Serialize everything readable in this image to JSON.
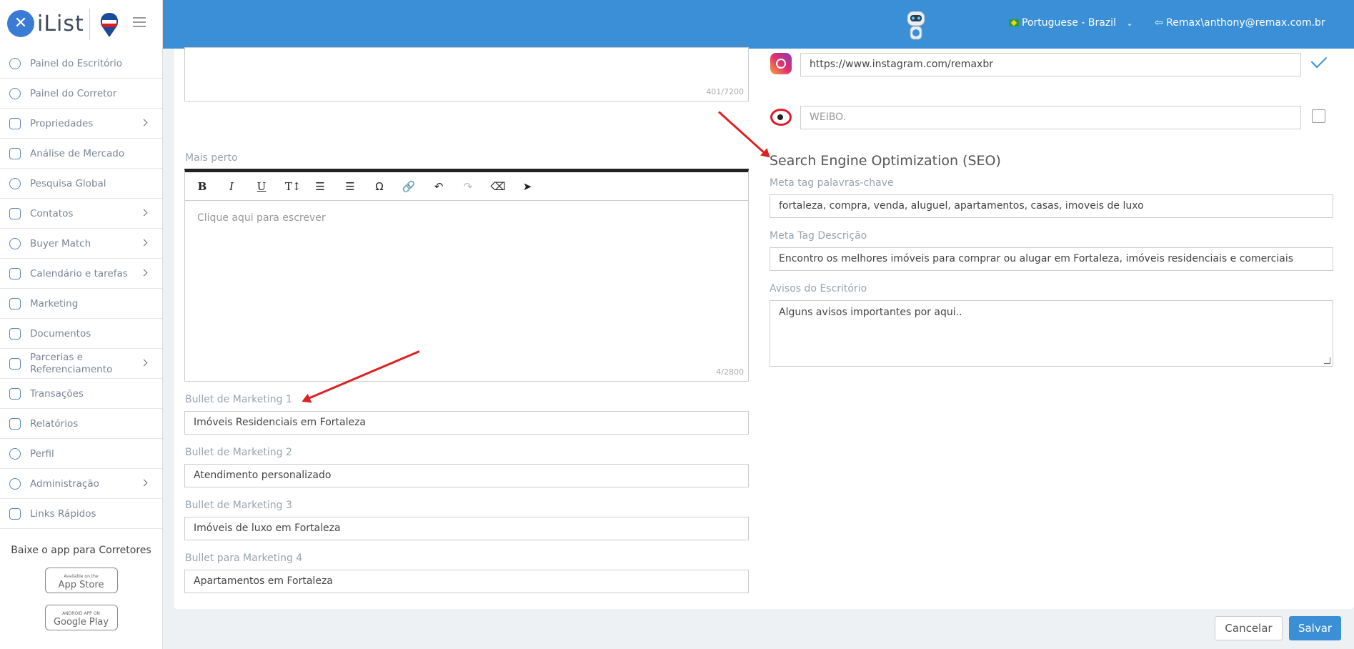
{
  "header": {
    "logo_text": "iList",
    "language": "Portuguese - Brazil",
    "user": "Remax\\anthony@remax.com.br",
    "brand_color": "#3a8fd6"
  },
  "sidebar": {
    "items": [
      {
        "label": "Painel do Escritório",
        "icon": "gauge-icon"
      },
      {
        "label": "Painel do Corretor",
        "icon": "gauge-icon"
      },
      {
        "label": "Propriedades",
        "icon": "home-icon",
        "has_children": true
      },
      {
        "label": "Análise de Mercado",
        "icon": "bar-chart-icon"
      },
      {
        "label": "Pesquisa Global",
        "icon": "search-icon"
      },
      {
        "label": "Contatos",
        "icon": "contacts-icon",
        "has_children": true
      },
      {
        "label": "Buyer Match",
        "icon": "user-icon",
        "has_children": true
      },
      {
        "label": "Calendário e tarefas",
        "icon": "calendar-icon",
        "has_children": true
      },
      {
        "label": "Marketing",
        "icon": "book-icon"
      },
      {
        "label": "Documentos",
        "icon": "folder-icon"
      },
      {
        "label": "Parcerias e Referenciamento",
        "icon": "handshake-icon",
        "has_children": true
      },
      {
        "label": "Transações",
        "icon": "briefcase-icon"
      },
      {
        "label": "Relatórios",
        "icon": "bar-chart-icon"
      },
      {
        "label": "Perfil",
        "icon": "user-icon"
      },
      {
        "label": "Administração",
        "icon": "gear-icon",
        "has_children": true
      },
      {
        "label": "Links Rápidos",
        "icon": "building-icon"
      }
    ],
    "app_title": "Baixe o app para Corretores",
    "app_store": {
      "small": "Available on the",
      "big": "App Store"
    },
    "google_play": {
      "small": "ANDROID APP ON",
      "big": "Google Play"
    }
  },
  "left": {
    "top_counter": "401/7200",
    "mais_perto_label": "Mais perto",
    "editor_placeholder": "Clique aqui para escrever",
    "editor_counter": "4/2800",
    "bullets": [
      {
        "label": "Bullet de Marketing 1",
        "value": "Imóveis Residenciais em Fortaleza"
      },
      {
        "label": "Bullet de Marketing 2",
        "value": "Atendimento personalizado"
      },
      {
        "label": "Bullet de Marketing 3",
        "value": "Imóveis de luxo em Fortaleza"
      },
      {
        "label": "Bullet para Marketing 4",
        "value": "Apartamentos em Fortaleza"
      }
    ]
  },
  "right": {
    "instagram_value": "https://www.instagram.com/remaxbr",
    "weibo_placeholder": "WEIBO.",
    "seo_title": "Search Engine Optimization (SEO)",
    "keywords_label": "Meta tag palavras-chave",
    "keywords_value": "fortaleza, compra, venda, aluguel, apartamentos, casas, imoveis de luxo",
    "description_label": "Meta Tag Descrição",
    "description_value": "Encontro os melhores imóveis para comprar ou alugar em Fortaleza, imóveis residenciais e comerciais",
    "notices_label": "Avisos do Escritório",
    "notices_value": "Alguns avisos importantes por aqui.."
  },
  "footer": {
    "cancel_label": "Cancelar",
    "save_label": "Salvar"
  }
}
